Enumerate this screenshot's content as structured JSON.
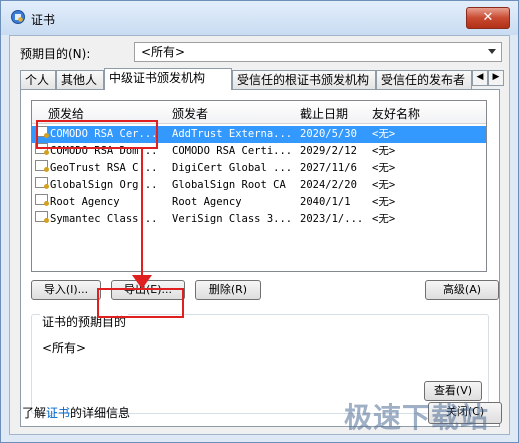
{
  "window": {
    "title": "证书",
    "close_symbol": "✕"
  },
  "purpose": {
    "label": "预期目的(N):",
    "selected": "<所有>"
  },
  "tabs": [
    {
      "label": "个人"
    },
    {
      "label": "其他人"
    },
    {
      "label": "中级证书颁发机构",
      "active": true
    },
    {
      "label": "受信任的根证书颁发机构"
    },
    {
      "label": "受信任的发布者"
    }
  ],
  "tab_scroll": {
    "left": "◀",
    "right": "▶"
  },
  "list": {
    "columns": [
      "颁发给",
      "颁发者",
      "截止日期",
      "友好名称"
    ],
    "rows": [
      {
        "issued_to": "COMODO RSA Cer...",
        "issued_by": "AddTrust Externa...",
        "expires": "2020/5/30",
        "friendly": "<无>",
        "selected": true
      },
      {
        "issued_to": "COMODO RSA Dom...",
        "issued_by": "COMODO RSA Certi...",
        "expires": "2029/2/12",
        "friendly": "<无>"
      },
      {
        "issued_to": "GeoTrust RSA C...",
        "issued_by": "DigiCert Global ...",
        "expires": "2027/11/6",
        "friendly": "<无>"
      },
      {
        "issued_to": "GlobalSign Org...",
        "issued_by": "GlobalSign Root CA",
        "expires": "2024/2/20",
        "friendly": "<无>"
      },
      {
        "issued_to": "Root Agency",
        "issued_by": "Root Agency",
        "expires": "2040/1/1",
        "friendly": "<无>"
      },
      {
        "issued_to": "Symantec Class...",
        "issued_by": "VeriSign Class 3...",
        "expires": "2023/1/...",
        "friendly": "<无>"
      }
    ]
  },
  "buttons": {
    "import": "导入(I)...",
    "export": "导出(E)...",
    "remove": "删除(R)",
    "advanced": "高级(A)",
    "view": "查看(V)",
    "close": "关闭(C)"
  },
  "purpose_group": {
    "title": "证书的预期目的",
    "value": "<所有>"
  },
  "learn_more": {
    "prefix": "了解",
    "link": "证书",
    "suffix": "的详细信息"
  },
  "watermark": "极速下载站",
  "colors": {
    "selection": "#3399ff",
    "annotation": "#e02020",
    "link": "#0066cc"
  }
}
